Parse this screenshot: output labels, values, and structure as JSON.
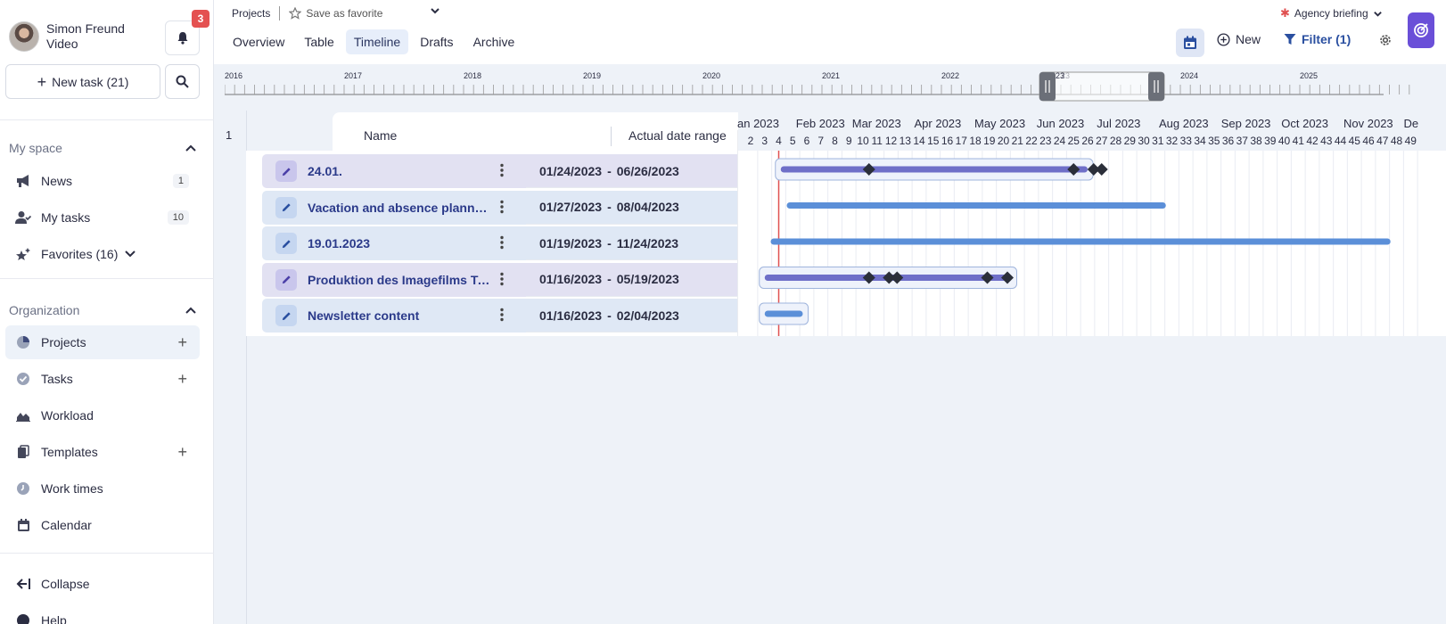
{
  "user": {
    "name": "Simon Freund",
    "role": "Video",
    "notifications": "3"
  },
  "sidebar": {
    "new_task": "New task (21)",
    "my_space": "My space",
    "items_my": [
      {
        "label": "News",
        "count": "1"
      },
      {
        "label": "My tasks",
        "count": "10"
      },
      {
        "label": "Favorites (16)"
      }
    ],
    "organization": "Organization",
    "items_org": [
      {
        "label": "Projects"
      },
      {
        "label": "Tasks"
      },
      {
        "label": "Workload"
      },
      {
        "label": "Templates"
      },
      {
        "label": "Work times"
      },
      {
        "label": "Calendar"
      }
    ],
    "collapse": "Collapse",
    "help": "Help"
  },
  "header": {
    "breadcrumb": "Projects",
    "save_favorite": "Save as favorite",
    "agency": "Agency briefing",
    "tabs": [
      "Overview",
      "Table",
      "Timeline",
      "Drafts",
      "Archive"
    ],
    "active_tab": "Timeline",
    "new_label": "New",
    "filter_label": "Filter (1)"
  },
  "timeline": {
    "years": [
      "2016",
      "2017",
      "2018",
      "2019",
      "2020",
      "2021",
      "2022",
      "23",
      "2024",
      "2025"
    ],
    "row_number": "1",
    "columns": {
      "name": "Name",
      "range": "Actual date range"
    },
    "months": [
      "an 2023",
      "Feb 2023",
      "Mar 2023",
      "Apr 2023",
      "May 2023",
      "Jun 2023",
      "Jul 2023",
      "Aug 2023",
      "Sep 2023",
      "Oct 2023",
      "Nov 2023",
      "De"
    ],
    "weeks": [
      "2",
      "3",
      "4",
      "5",
      "6",
      "7",
      "8",
      "9",
      "10",
      "11",
      "12",
      "13",
      "14",
      "15",
      "16",
      "17",
      "18",
      "19",
      "20",
      "21",
      "22",
      "23",
      "24",
      "25",
      "26",
      "27",
      "28",
      "29",
      "30",
      "31",
      "32",
      "33",
      "34",
      "35",
      "36",
      "37",
      "38",
      "39",
      "40",
      "41",
      "42",
      "43",
      "44",
      "45",
      "46",
      "47",
      "48",
      "49"
    ],
    "rows": [
      {
        "name": "24.01.",
        "start": "01/24/2023",
        "end": "06/26/2023",
        "style": "purple"
      },
      {
        "name": "Vacation and absence planning",
        "start": "01/27/2023",
        "end": "08/04/2023",
        "style": "blue"
      },
      {
        "name": "19.01.2023",
        "start": "01/19/2023",
        "end": "11/24/2023",
        "style": "blue"
      },
      {
        "name": "Produktion des Imagefilms Te...",
        "start": "01/16/2023",
        "end": "05/19/2023",
        "style": "purple"
      },
      {
        "name": "Newsletter content",
        "start": "01/16/2023",
        "end": "02/04/2023",
        "style": "blue"
      }
    ],
    "milestones": [
      [
        "03/09/2023",
        "06/19/2023",
        "06/29/2023",
        "07/03/2023"
      ],
      [],
      [],
      [
        "03/09/2023",
        "03/19/2023",
        "03/23/2023",
        "05/07/2023",
        "05/17/2023"
      ],
      []
    ],
    "today": "01/23/2023"
  },
  "colors": {
    "accent": "#2a4fa0",
    "purple_bar": "#6f6fc8",
    "blue_bar": "#5b8fd8",
    "purple_row": "#e2e1f2",
    "blue_row": "#dfe8f5",
    "today_line": "#e05050",
    "brand": "#6a4fd8"
  }
}
